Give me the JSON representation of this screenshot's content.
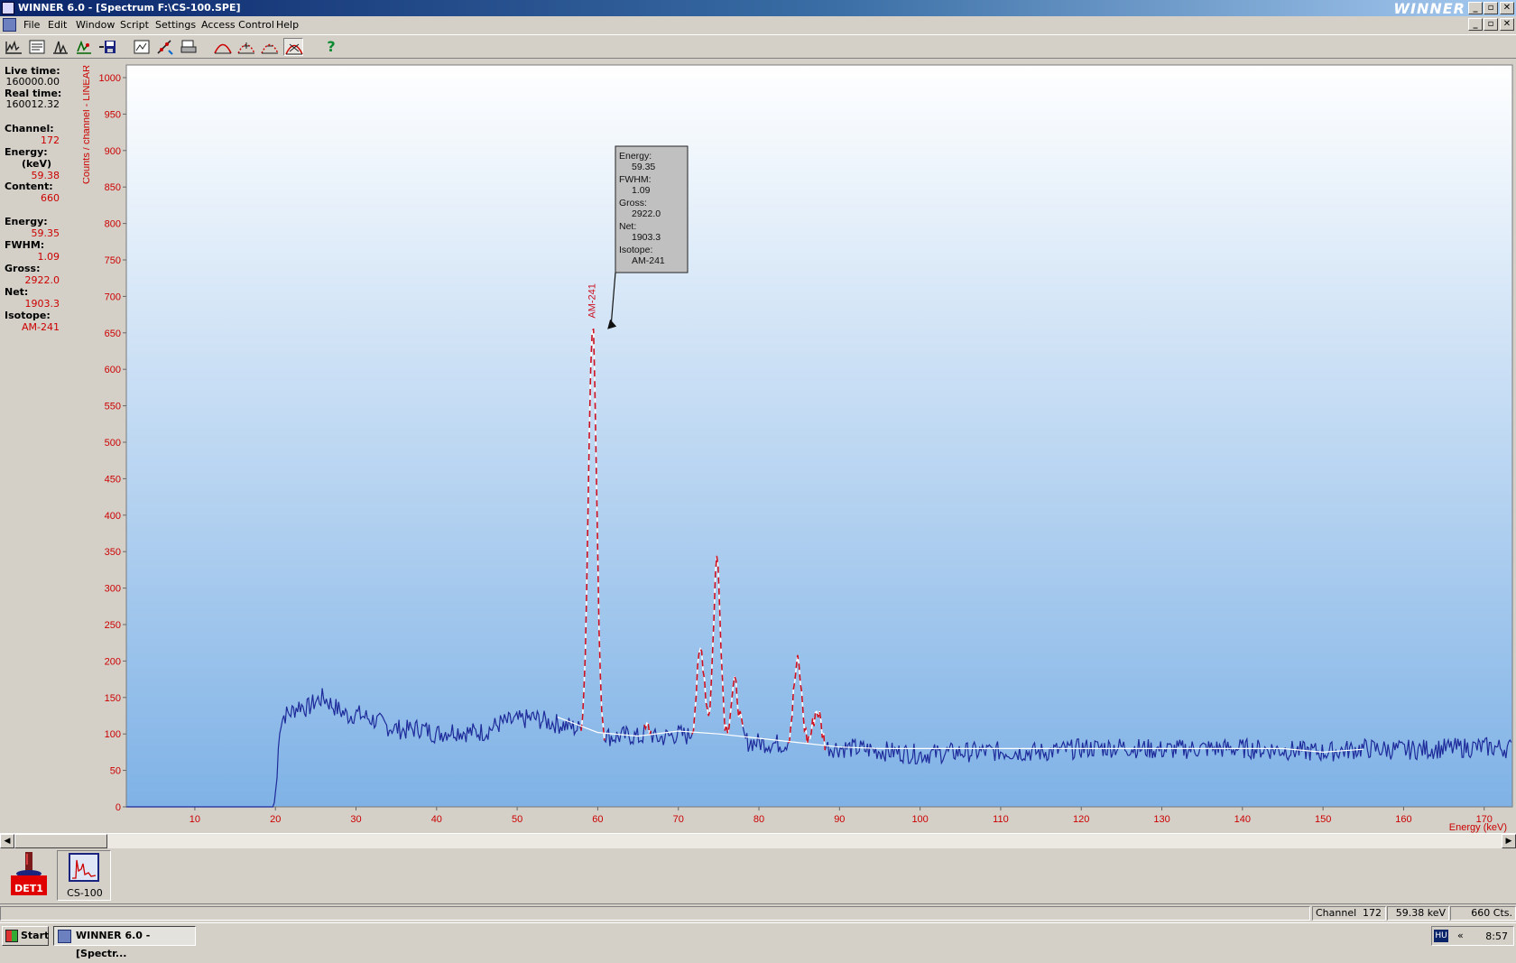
{
  "window": {
    "title": "WINNER 6.0 - [Spectrum F:\\CS-100.SPE]",
    "brand": "WINNER",
    "buttons": [
      "_",
      "▫",
      "✕"
    ]
  },
  "menu": {
    "items": [
      "File",
      "Edit",
      "Window",
      "Script",
      "Settings",
      "Access Control",
      "Help"
    ]
  },
  "toolbar": {
    "icons": [
      "spectrum-view-icon",
      "list-view-icon",
      "peak-search-icon",
      "analysis-icon",
      "save-disk-icon",
      "report-icon",
      "calibration-icon",
      "print-icon",
      "curve-icon",
      "roi-icon",
      "roi-marker-icon",
      "peak-label-icon",
      "help-icon"
    ],
    "help_label": "?"
  },
  "info": {
    "live_time_label": "Live time:",
    "live_time": "160000.00",
    "real_time_label": "Real time:",
    "real_time": "160012.32",
    "channel_label": "Channel:",
    "channel": "172",
    "energy_label": "Energy:",
    "energy_unit_label": "(keV)",
    "energy": "59.38",
    "content_label": "Content:",
    "content": "660",
    "peak_energy_label": "Energy:",
    "peak_energy": "59.35",
    "fwhm_label": "FWHM:",
    "fwhm": "1.09",
    "gross_label": "Gross:",
    "gross": "2922.0",
    "net_label": "Net:",
    "net": "1903.3",
    "isotope_label": "Isotope:",
    "isotope": "AM-241"
  },
  "chart_data": {
    "type": "line",
    "ylabel": "Counts / channel - LINEAR",
    "xlabel": "Energy (keV)",
    "xlim": [
      1.5,
      173.5
    ],
    "ylim": [
      0,
      1000
    ],
    "x_ticks": [
      10,
      20,
      30,
      40,
      50,
      60,
      70,
      80,
      90,
      100,
      110,
      120,
      130,
      140,
      150,
      160,
      170
    ],
    "y_ticks": [
      0,
      50,
      100,
      150,
      200,
      250,
      300,
      350,
      400,
      450,
      500,
      550,
      600,
      650,
      700,
      750,
      800,
      850,
      900,
      950,
      1000
    ],
    "colors": {
      "spectrum": "#1e2a9a",
      "peaks": "#cc1020",
      "background": "#ffffff",
      "axis_text": "#cc0000"
    },
    "spectrum": [
      [
        1.5,
        0
      ],
      [
        19.8,
        0
      ],
      [
        20.2,
        40
      ],
      [
        20.5,
        110
      ],
      [
        21,
        125
      ],
      [
        22,
        130
      ],
      [
        23,
        140
      ],
      [
        24,
        135
      ],
      [
        25,
        145
      ],
      [
        26,
        150
      ],
      [
        27,
        140
      ],
      [
        28,
        132
      ],
      [
        29,
        125
      ],
      [
        30,
        128
      ],
      [
        32,
        120
      ],
      [
        34,
        110
      ],
      [
        36,
        105
      ],
      [
        38,
        108
      ],
      [
        40,
        100
      ],
      [
        42,
        105
      ],
      [
        44,
        102
      ],
      [
        46,
        103
      ],
      [
        48,
        115
      ],
      [
        50,
        118
      ],
      [
        52,
        122
      ],
      [
        54,
        116
      ],
      [
        56,
        112
      ],
      [
        58,
        105
      ],
      [
        60,
        98
      ],
      [
        62,
        96
      ],
      [
        64,
        98
      ],
      [
        66,
        92
      ],
      [
        68,
        95
      ],
      [
        70,
        100
      ],
      [
        72,
        95
      ],
      [
        74,
        94
      ],
      [
        76,
        92
      ],
      [
        78,
        90
      ],
      [
        80,
        88
      ],
      [
        84,
        86
      ],
      [
        88,
        82
      ],
      [
        92,
        80
      ],
      [
        96,
        76
      ],
      [
        100,
        72
      ],
      [
        105,
        75
      ],
      [
        110,
        76
      ],
      [
        115,
        75
      ],
      [
        120,
        80
      ],
      [
        125,
        82
      ],
      [
        130,
        78
      ],
      [
        135,
        80
      ],
      [
        140,
        80
      ],
      [
        145,
        78
      ],
      [
        150,
        75
      ],
      [
        155,
        80
      ],
      [
        160,
        78
      ],
      [
        165,
        80
      ],
      [
        170,
        82
      ],
      [
        173.5,
        80
      ]
    ],
    "peaks": [
      {
        "center": 59.35,
        "height": 660,
        "sigma": 0.5
      },
      {
        "center": 66.2,
        "height": 110,
        "sigma": 0.4
      },
      {
        "center": 72.8,
        "height": 215,
        "sigma": 0.5
      },
      {
        "center": 74.8,
        "height": 342,
        "sigma": 0.45
      },
      {
        "center": 77.0,
        "height": 170,
        "sigma": 0.5
      },
      {
        "center": 84.8,
        "height": 207,
        "sigma": 0.5
      },
      {
        "center": 87.2,
        "height": 145,
        "sigma": 0.5
      },
      {
        "center": 148.0,
        "height": 95,
        "sigma": 0.4
      }
    ],
    "background_line": [
      [
        55,
        123
      ],
      [
        60,
        102
      ],
      [
        65,
        97
      ],
      [
        70,
        104
      ],
      [
        75,
        100
      ],
      [
        80,
        94
      ],
      [
        85,
        88
      ],
      [
        90,
        82
      ],
      [
        95,
        80
      ],
      [
        145,
        80
      ],
      [
        150,
        75
      ],
      [
        155,
        79
      ]
    ],
    "annotation": {
      "peak_label": "AM-241",
      "peak_label_at": [
        59.35,
        670
      ],
      "arrow_to": [
        61.2,
        655
      ],
      "box_lines": [
        {
          "label": "Energy:",
          "value": "59.35"
        },
        {
          "label": "FWHM:",
          "value": "1.09"
        },
        {
          "label": "Gross:",
          "value": "2922.0"
        },
        {
          "label": "Net:",
          "value": "1903.3"
        },
        {
          "label": "Isotope:",
          "value": "AM-241"
        }
      ]
    }
  },
  "tiles": [
    {
      "caption": "DET1",
      "icon": "detector-icon"
    },
    {
      "caption": "CS-100",
      "icon": "spectrum-tile-icon"
    }
  ],
  "status": {
    "channel_label": "Channel",
    "channel": "172",
    "energy": "59.38 keV",
    "counts": "660 Cts."
  },
  "taskbar": {
    "start": "Start",
    "task": "WINNER 6.0 - [Spectr...",
    "lang": "HU",
    "chevron": "«",
    "time": "8:57"
  }
}
